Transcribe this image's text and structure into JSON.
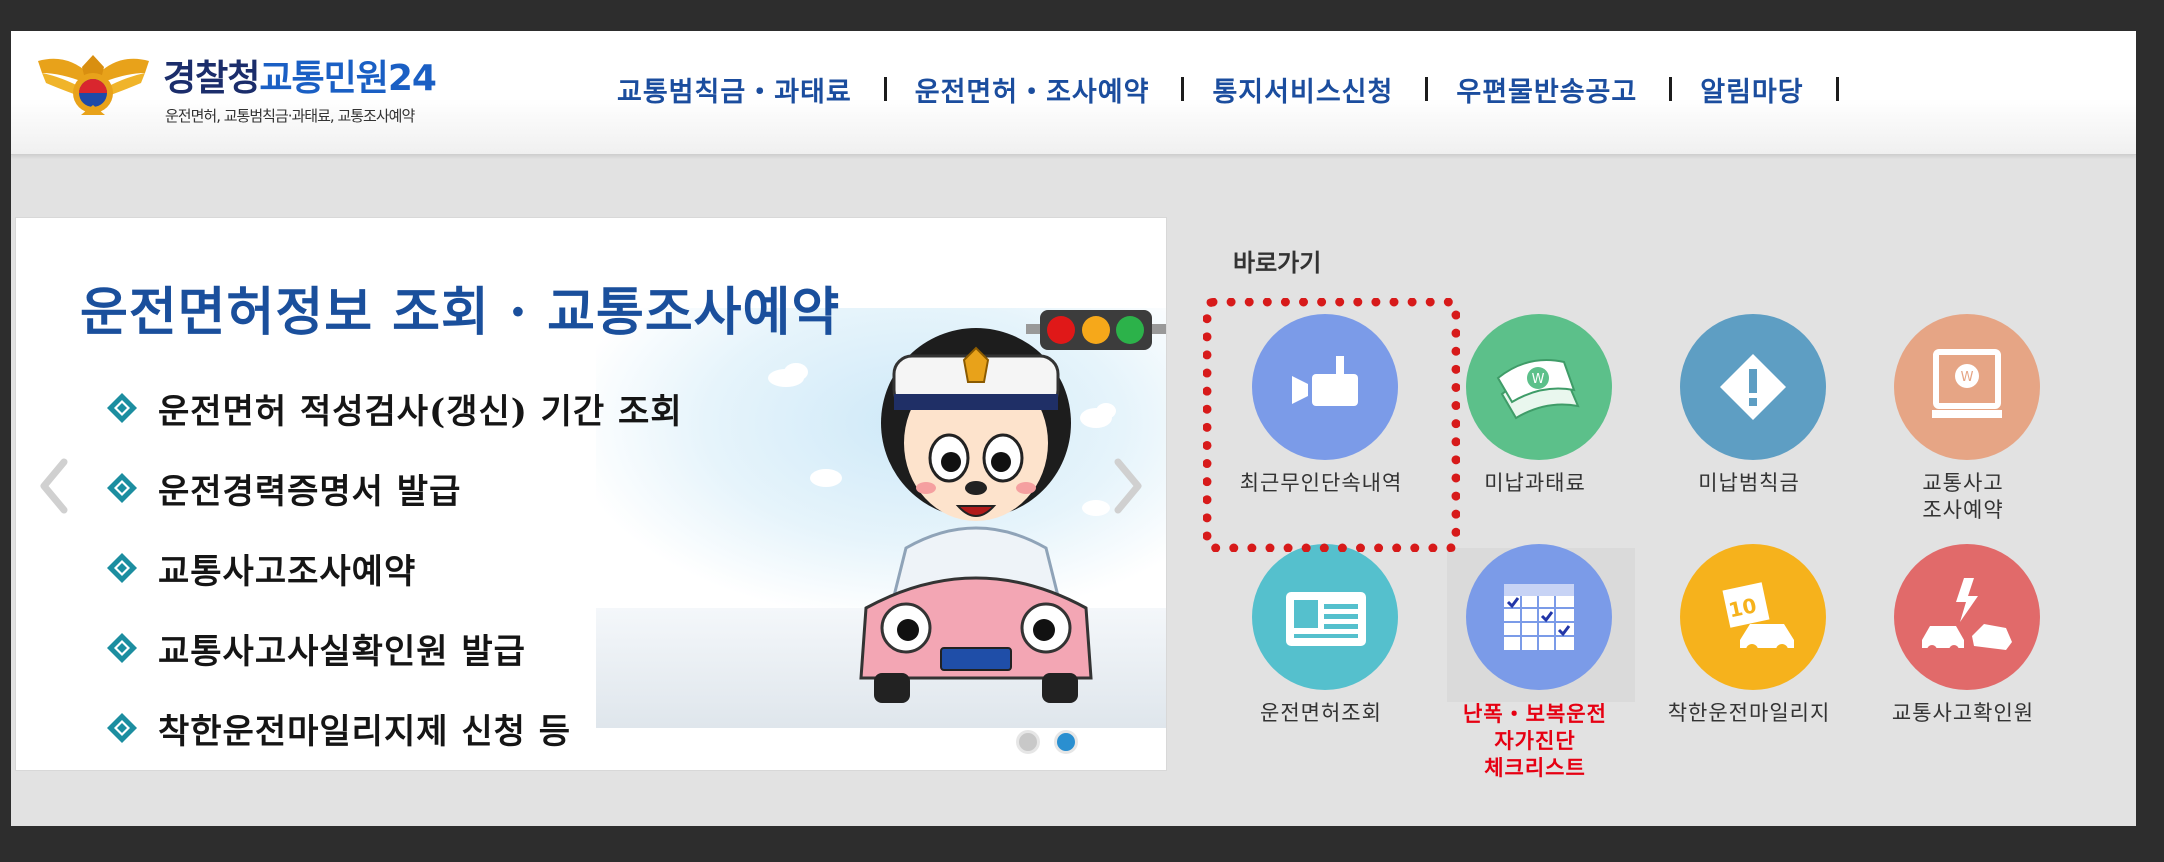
{
  "header": {
    "logo_title_a": "경찰청",
    "logo_title_b": "교통민원24",
    "logo_sub": "운전면허, 교통범칙금·과태료, 교통조사예약",
    "nav": [
      {
        "label": "교통범칙금・과태료"
      },
      {
        "label": "운전면허・조사예약"
      },
      {
        "label": "통지서비스신청"
      },
      {
        "label": "우편물반송공고"
      },
      {
        "label": "알림마당"
      }
    ]
  },
  "slider": {
    "title": "운전면허정보 조회 · 교통조사예약",
    "items": [
      "운전면허 적성검사(갱신) 기간 조회",
      "운전경력증명서 발급",
      "교통사고조사예약",
      "교통사고사실확인원 발급",
      "착한운전마일리지제 신청 등"
    ],
    "page_count": 2,
    "active_page": 2
  },
  "quick": {
    "title": "바로가기",
    "items": [
      {
        "label": "최근무인단속내역",
        "icon": "cctv-camera-icon",
        "color": "#7b9be8"
      },
      {
        "label": "미납과태료",
        "icon": "money-icon",
        "color": "#5cc08a"
      },
      {
        "label": "미납범칙금",
        "icon": "warning-diamond-icon",
        "color": "#5e9ec3"
      },
      {
        "label": "교통사고\n조사예약",
        "icon": "computer-won-icon",
        "color": "#e6a585"
      },
      {
        "label": "운전면허조회",
        "icon": "id-card-icon",
        "color": "#55c0cd"
      },
      {
        "label": "난폭・보복운전\n자가진단\n체크리스트",
        "icon": "calendar-check-icon",
        "color": "#7b9be8"
      },
      {
        "label": "착한운전마일리지",
        "icon": "mileage-car-icon",
        "color": "#f6b21c"
      },
      {
        "label": "교통사고확인원",
        "icon": "car-crash-icon",
        "color": "#e16a6a"
      }
    ]
  },
  "colors": {
    "accent_blue": "#1a4f9c",
    "highlight_red": "#d71a1a",
    "alert_red": "#e60012"
  }
}
